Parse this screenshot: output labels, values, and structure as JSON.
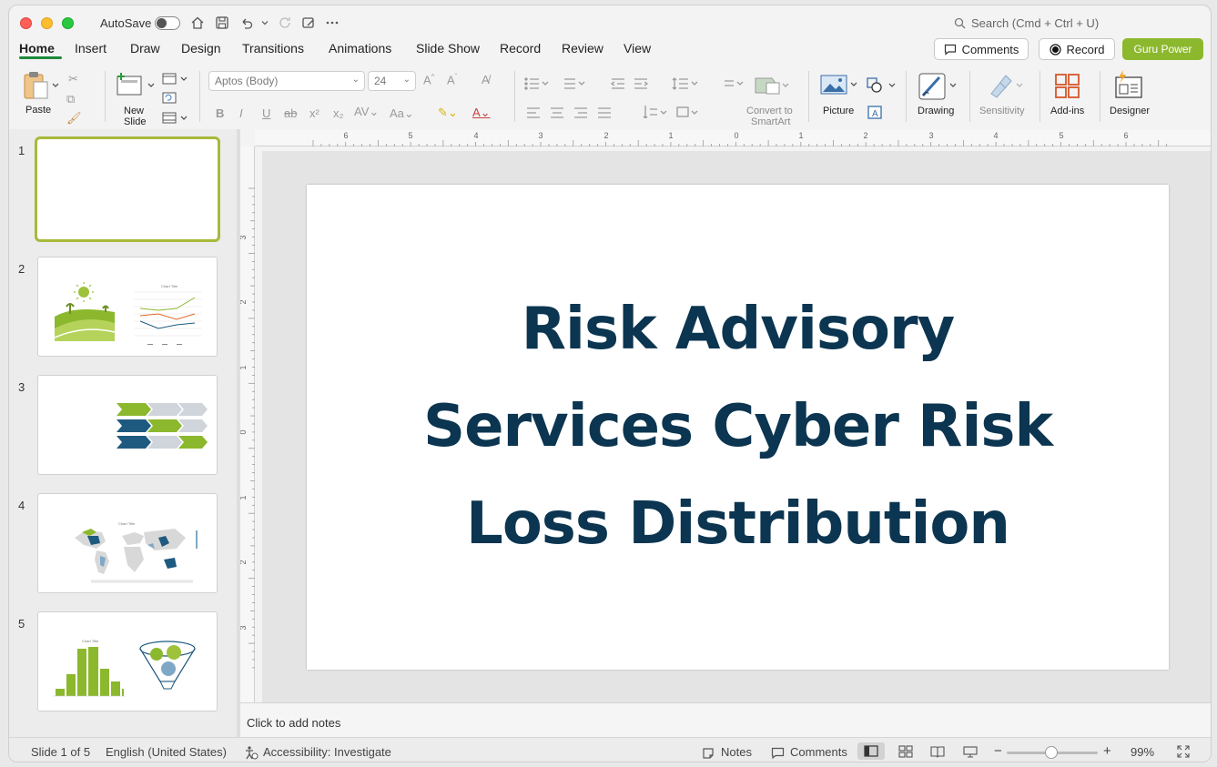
{
  "titlebar": {
    "autosave_label": "AutoSave",
    "search_placeholder": "Search (Cmd + Ctrl + U)"
  },
  "menu": {
    "tabs": [
      "Home",
      "Insert",
      "Draw",
      "Design",
      "Transitions",
      "Animations",
      "Slide Show",
      "Record",
      "Review",
      "View"
    ],
    "active": "Home"
  },
  "actions": {
    "comments": "Comments",
    "record": "Record",
    "guru": "Guru Power"
  },
  "ribbon": {
    "paste": "Paste",
    "new_slide_1": "New",
    "new_slide_2": "Slide",
    "font_name": "Aptos (Body)",
    "font_size": "24",
    "convert_1": "Convert to",
    "convert_2": "SmartArt",
    "picture": "Picture",
    "drawing": "Drawing",
    "sensitivity": "Sensitivity",
    "addins": "Add-ins",
    "designer": "Designer"
  },
  "thumbnails": {
    "numbers": [
      "1",
      "2",
      "3",
      "4",
      "5"
    ],
    "chart_title": "Chart Title"
  },
  "ruler": {
    "h_ticks": [
      "6",
      "5",
      "4",
      "3",
      "2",
      "1",
      "0",
      "1",
      "2",
      "3",
      "4",
      "5",
      "6"
    ],
    "v_ticks": [
      "3",
      "2",
      "1",
      "0",
      "1",
      "2",
      "3"
    ]
  },
  "slide": {
    "title": "Risk Advisory Services Cyber Risk Loss Distribution"
  },
  "notes": {
    "placeholder": "Click to add notes"
  },
  "status": {
    "slide_count": "Slide 1 of 5",
    "language": "English (United States)",
    "accessibility": "Accessibility: Investigate",
    "notes": "Notes",
    "comments": "Comments",
    "zoom_minus": "−",
    "zoom_plus": "+",
    "zoom": "99%"
  },
  "colors": {
    "accent_green": "#8cb82e",
    "title_navy": "#0b3550",
    "thumb_blue": "#1e5a80",
    "thumb_gray": "#d0d5dc"
  }
}
